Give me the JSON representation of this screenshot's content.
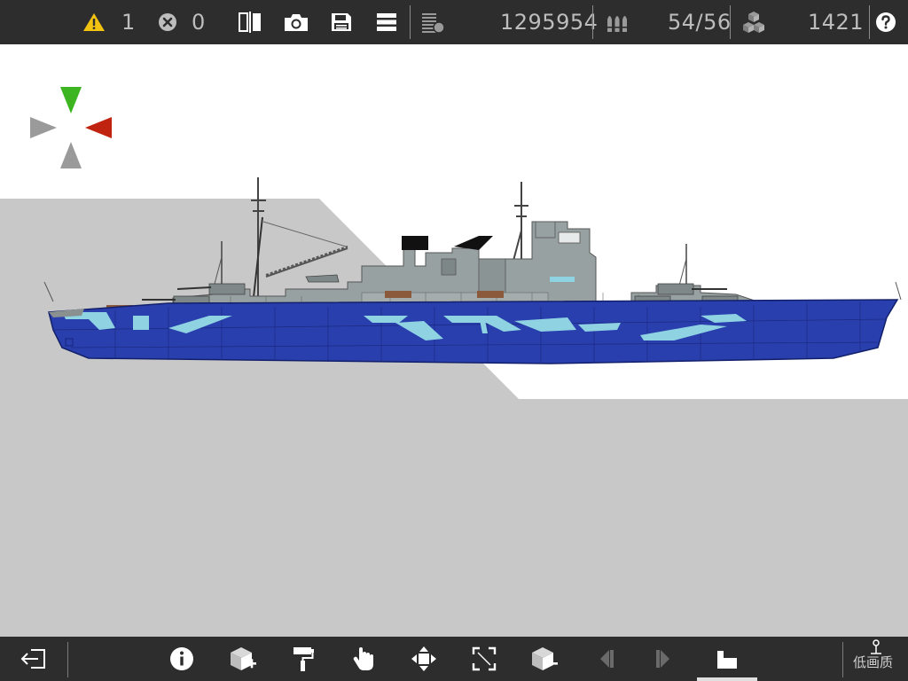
{
  "status": {
    "warnings": "1",
    "errors": "0",
    "mass": "1295954",
    "ammo": "54/56",
    "blocks": "1421"
  },
  "icons": {
    "warning": "warning-triangle-icon",
    "error": "error-circle-icon",
    "mirror": "mirror-icon",
    "screenshot": "camera-icon",
    "save": "save-icon",
    "menu": "menu-icon",
    "mass": "weight-icon",
    "ammo": "ammo-icon",
    "blocks": "blocks-icon",
    "help": "help-icon"
  },
  "toolbar": {
    "exit": "exit-icon",
    "info": "info-icon",
    "add_part": "add-block-icon",
    "paint": "paint-roller-icon",
    "select": "hand-icon",
    "move": "move-icon",
    "resize": "resize-icon",
    "remove_part": "remove-block-icon",
    "prev": "prev-icon",
    "next": "next-icon",
    "view_mode": "view-mode-icon",
    "low_quality_label": "低画质"
  },
  "colors": {
    "bar_bg": "#2d2d2d",
    "hull_blue": "#2a3fae",
    "hull_light_blue": "#8fd3e3",
    "superstructure_gray": "#98a1a1",
    "ground_gray": "#c8c8c8",
    "axis_green": "#3cb521",
    "axis_red": "#c0230f",
    "axis_gray": "#9a9a9a",
    "warning_yellow": "#f2c311"
  }
}
